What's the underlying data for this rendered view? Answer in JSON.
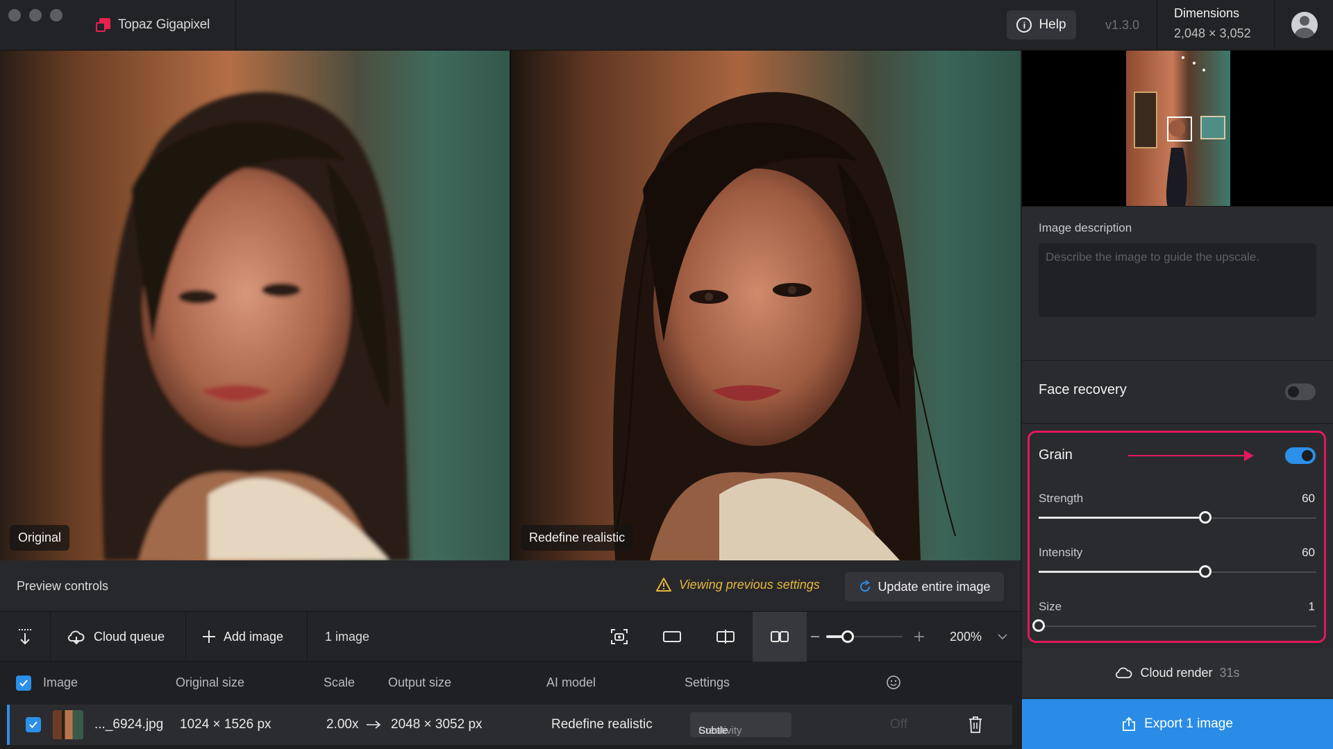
{
  "app": {
    "name": "Topaz Gigapixel",
    "version": "v1.3.0",
    "help_label": "Help"
  },
  "dimensions": {
    "title": "Dimensions",
    "value": "2,048 × 3,052"
  },
  "preview": {
    "left_label": "Original",
    "right_label": "Redefine realistic"
  },
  "preview_controls": {
    "label": "Preview controls",
    "warning": "Viewing previous settings",
    "update_label": "Update entire image"
  },
  "toolbar": {
    "cloud_queue": "Cloud queue",
    "add_image": "Add image",
    "image_count": "1 image",
    "zoom": "200%"
  },
  "table": {
    "headers": {
      "image": "Image",
      "original_size": "Original size",
      "scale": "Scale",
      "output_size": "Output size",
      "ai_model": "AI model",
      "settings": "Settings"
    },
    "rows": [
      {
        "name": "..._6924.jpg",
        "original_size": "1024 × 1526 px",
        "scale": "2.00x",
        "output_size": "2048 × 3052 px",
        "ai_model": "Redefine realistic",
        "creativity_label": "Creativity",
        "creativity_value": "Subtle",
        "face": "Off"
      }
    ]
  },
  "panel": {
    "description_label": "Image description",
    "description_placeholder": "Describe the image to guide the upscale.",
    "face_recovery_label": "Face recovery",
    "face_recovery_on": false,
    "grain_label": "Grain",
    "grain_on": true,
    "sliders": [
      {
        "label": "Strength",
        "value": "60",
        "fraction": 0.6
      },
      {
        "label": "Intensity",
        "value": "60",
        "fraction": 0.6
      },
      {
        "label": "Size",
        "value": "1",
        "fraction": 0.0
      }
    ],
    "cloud_render_label": "Cloud render",
    "cloud_render_time": "31s",
    "export_label": "Export 1 image"
  },
  "colors": {
    "accent": "#2c8fe8",
    "highlight": "#e3195b",
    "warning": "#e8b73c"
  }
}
